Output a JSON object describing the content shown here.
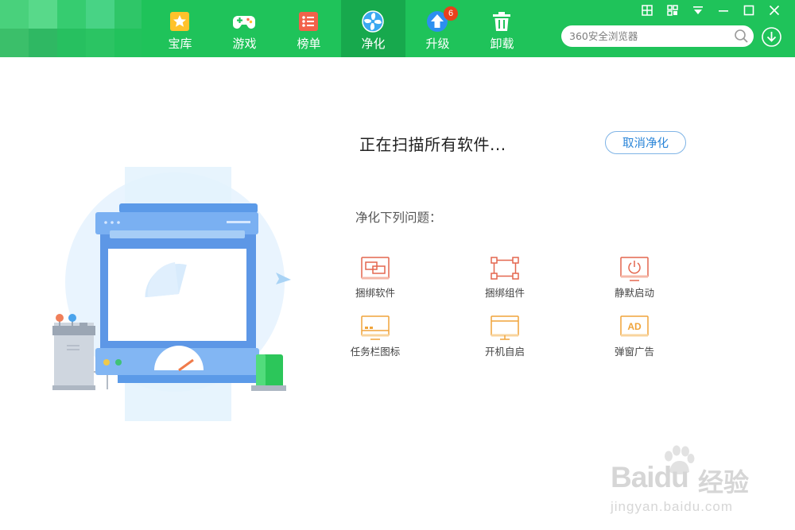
{
  "nav": {
    "tabs": [
      {
        "label": "宝库",
        "icon": "star-box-icon"
      },
      {
        "label": "游戏",
        "icon": "gamepad-icon"
      },
      {
        "label": "榜单",
        "icon": "ranking-list-icon"
      },
      {
        "label": "净化",
        "icon": "fan-icon",
        "active": true
      },
      {
        "label": "升级",
        "icon": "upgrade-arrow-icon",
        "badge": "6"
      },
      {
        "label": "卸载",
        "icon": "trash-icon"
      }
    ]
  },
  "window_controls": [
    "grid-icon",
    "skin-icon",
    "menu-dropdown-icon",
    "minimize-icon",
    "maximize-icon",
    "close-icon"
  ],
  "search": {
    "placeholder": "360安全浏览器"
  },
  "main": {
    "status_text": "正在扫描所有软件...",
    "cancel_label": "取消净化",
    "issues_title": "净化下列问题：",
    "issues": [
      {
        "label": "捆绑软件",
        "icon": "bundled-software-icon",
        "color": "#e4674f"
      },
      {
        "label": "捆绑组件",
        "icon": "bundled-component-icon",
        "color": "#e4674f"
      },
      {
        "label": "静默启动",
        "icon": "silent-startup-icon",
        "color": "#e4674f"
      },
      {
        "label": "任务栏图标",
        "icon": "taskbar-icon",
        "color": "#f0a43a"
      },
      {
        "label": "开机自启",
        "icon": "autostart-icon",
        "color": "#f0a43a"
      },
      {
        "label": "弹窗广告",
        "icon": "popup-ad-icon",
        "color": "#f0a43a"
      }
    ]
  },
  "watermark": {
    "brand": "Baidu",
    "cn": "经验",
    "url": "jingyan.baidu.com"
  },
  "colors": {
    "header": "#1fc35a",
    "header_active": "#17a94d",
    "accent_blue": "#2a85d8",
    "badge": "#e8401c"
  }
}
